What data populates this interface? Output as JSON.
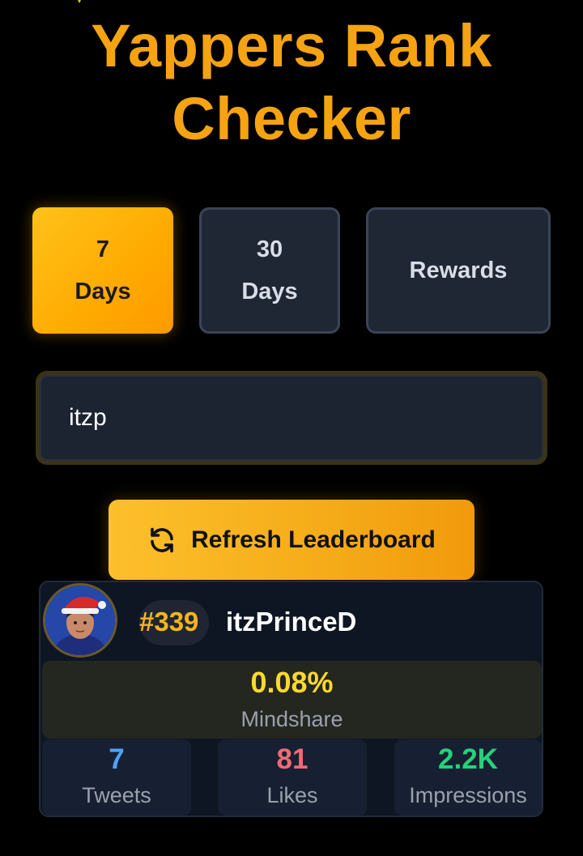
{
  "title": {
    "line1": "Yappers Rank",
    "line2": "Checker"
  },
  "tabs": [
    {
      "line1": "7",
      "line2": "Days",
      "active": true
    },
    {
      "line1": "30",
      "line2": "Days",
      "active": false
    },
    {
      "label": "Rewards",
      "active": false
    }
  ],
  "search": {
    "value": "itzp"
  },
  "refresh_button": {
    "label": "Refresh Leaderboard",
    "icon": "refresh-icon"
  },
  "result": {
    "rank": "#339",
    "username": "itzPrinceD",
    "mindshare": {
      "value": "0.08%",
      "label": "Mindshare"
    },
    "stats": [
      {
        "value": "7",
        "label": "Tweets",
        "color": "#4da3ff"
      },
      {
        "value": "81",
        "label": "Likes",
        "color": "#f06a75"
      },
      {
        "value": "2.2K",
        "label": "Impressions",
        "color": "#24d27a"
      }
    ]
  },
  "colors": {
    "accent": "#f5a313",
    "background": "#000000",
    "card": "#0f1623",
    "panel": "#1f2735"
  }
}
